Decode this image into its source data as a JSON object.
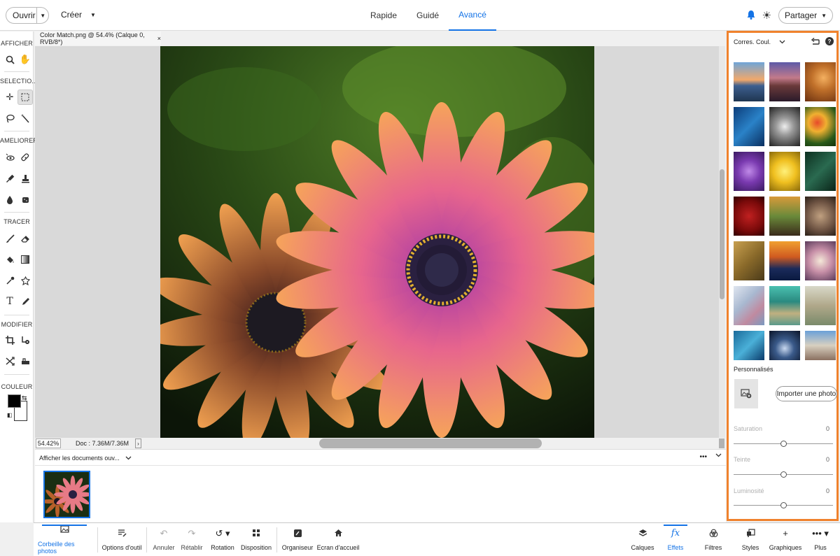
{
  "topbar": {
    "open_label": "Ouvrir",
    "create_label": "Créer",
    "modes": [
      {
        "label": "Rapide",
        "active": false
      },
      {
        "label": "Guidé",
        "active": false
      },
      {
        "label": "Avancé",
        "active": true
      }
    ],
    "share_label": "Partager"
  },
  "toolbar": {
    "sections": [
      "AFFICHER",
      "SELECTIO...",
      "AMELIORER",
      "TRACER",
      "MODIFIER",
      "COULEUR"
    ]
  },
  "document": {
    "tab_title": "Color Match.png @ 54.4% (Calque 0, RVB/8*)",
    "close_glyph": "×",
    "zoom": "54.42%",
    "doc_size": "Doc : 7.36M/7.36M"
  },
  "photo_bin": {
    "dropdown_label": "Afficher les documents ouv...",
    "more_glyph": "•••"
  },
  "panel": {
    "title": "Corres. Coul.",
    "custom_label": "Personnalisés",
    "import_label": "Importer une photo",
    "sliders": [
      {
        "label": "Saturation",
        "value": "0"
      },
      {
        "label": "Teinte",
        "value": "0"
      },
      {
        "label": "Luminosité",
        "value": "0"
      }
    ]
  },
  "bottombar": {
    "items": [
      {
        "label": "Corbeille des photos",
        "icon": "photo-bin-icon",
        "active": true
      },
      {
        "label": "Options d'outil",
        "icon": "tool-options-icon"
      },
      {
        "label": "Annuler",
        "icon": "undo-icon"
      },
      {
        "label": "Rétablir",
        "icon": "redo-icon"
      },
      {
        "label": "Rotation",
        "icon": "rotate-icon"
      },
      {
        "label": "Disposition",
        "icon": "layout-icon"
      },
      {
        "label": "Organiseur",
        "icon": "organizer-icon"
      },
      {
        "label": "Ecran d'accueil",
        "icon": "home-icon"
      },
      {
        "label": "Calques",
        "icon": "layers-icon"
      },
      {
        "label": "Effets",
        "icon": "fx-icon",
        "active": true
      },
      {
        "label": "Filtres",
        "icon": "filters-icon"
      },
      {
        "label": "Styles",
        "icon": "styles-icon"
      },
      {
        "label": "Graphiques",
        "icon": "graphics-icon"
      },
      {
        "label": "Plus",
        "icon": "more-icon"
      }
    ]
  },
  "colors": {
    "accent": "#1473e6",
    "panel_highlight": "#f0822d"
  }
}
